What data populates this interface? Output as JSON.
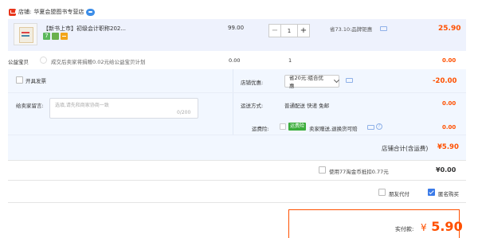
{
  "store": {
    "prefix": "店铺:",
    "name": "华夏会盟图书专营店"
  },
  "product": {
    "title": "【新书上市】初级会计职称202...",
    "unit_price": "99.00",
    "quantity": "1",
    "discount": "省73.10:品牌钜惠",
    "subtotal": "25.90"
  },
  "charity": {
    "label": "公益宝贝",
    "text": "成交后卖家将捐赠0.02元给公益宝贝计划",
    "price": "0.00",
    "quantity": "1",
    "total": "0.00"
  },
  "invoice": {
    "label": "开具发票"
  },
  "memo": {
    "label": "给卖家留言:",
    "placeholder": "选填,请先和商家协商一致",
    "count": "0/200"
  },
  "store_coupon": {
    "label": "店铺优惠:",
    "selected": "省20元:组合优惠",
    "amount": "-20.00"
  },
  "delivery": {
    "label": "运送方式:",
    "text": "普通配送 快递 免邮",
    "price": "0.00"
  },
  "shipping_insurance": {
    "label": "运费险:",
    "tag": "运费险",
    "text": "卖家赠送,退换货可赔",
    "help": "?",
    "price": "0.00"
  },
  "store_total": {
    "label": "店铺合计(含运费)",
    "value": "¥5.90"
  },
  "tmall_coins": {
    "text": "使用77淘金币抵扣0.77元",
    "amount": "¥0.00"
  },
  "friend_pay": {
    "label": "朋友代付",
    "checked": false
  },
  "anonymous": {
    "label": "匿名购买",
    "checked": true
  },
  "payment": {
    "label": "实付款:",
    "currency": "¥",
    "amount": "5.90"
  },
  "colors": {
    "accent": "#ff5000",
    "panel": "#f2f7ff",
    "product_bg": "#eef2fd",
    "check_blue": "#3a7ae8",
    "tag_green": "#3cad3c"
  },
  "icons": [
    "store-icon",
    "wangwang-icon",
    "chat-icon",
    "chevron-down-icon",
    "help-icon",
    "check-icon"
  ]
}
